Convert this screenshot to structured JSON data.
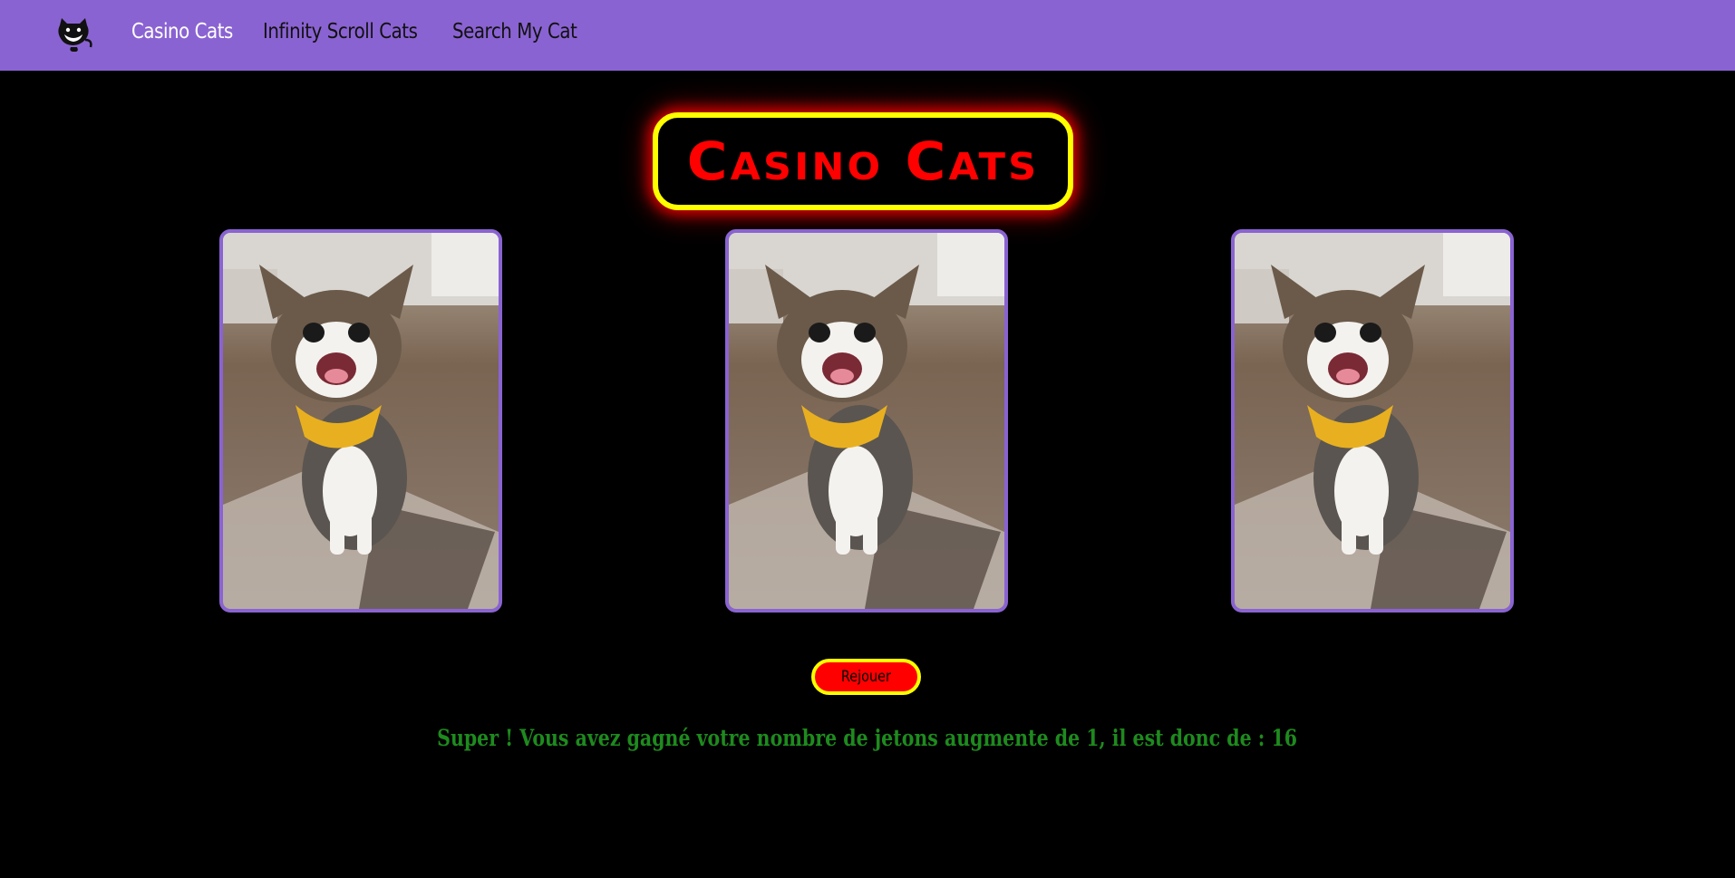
{
  "nav": {
    "logo_icon": "grinning-cat-icon",
    "links": [
      {
        "label": "Casino Cats",
        "active": true
      },
      {
        "label": "Infinity Scroll Cats",
        "active": false
      },
      {
        "label": "Search My Cat",
        "active": false
      }
    ],
    "background_color": "#8a63d2"
  },
  "game": {
    "title": "Casino Cats",
    "title_color": "#ff0000",
    "title_border_color": "#ffff00",
    "slots": [
      {
        "image": "cat-with-yellow-bandana-photo"
      },
      {
        "image": "cat-with-yellow-bandana-photo"
      },
      {
        "image": "cat-with-yellow-bandana-photo"
      }
    ],
    "replay_label": "Rejouer",
    "result_message": "Super ! Vous avez gagné votre nombre de jetons augmente de 1, il est donc de : 16",
    "result_color": "#1e8a1e"
  }
}
